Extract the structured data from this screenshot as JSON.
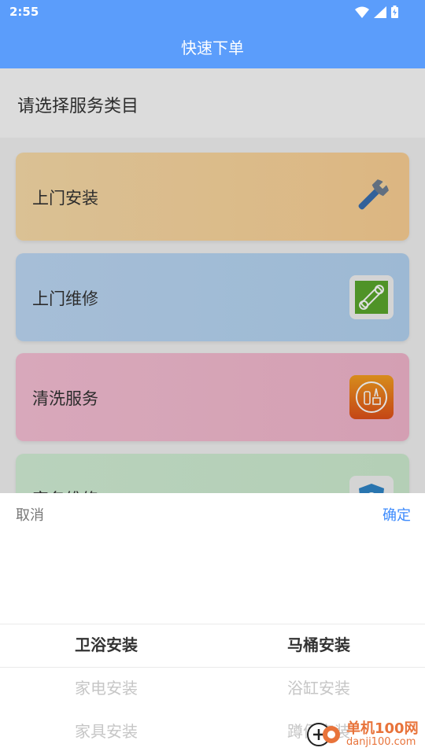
{
  "status_bar": {
    "time": "2:55"
  },
  "app_bar": {
    "title": "快速下单"
  },
  "section": {
    "title": "请选择服务类目"
  },
  "services": [
    {
      "label": "上门安装",
      "icon": "wrench-icon"
    },
    {
      "label": "上门维修",
      "icon": "wrench-tile-icon"
    },
    {
      "label": "清洗服务",
      "icon": "cleaning-tools-icon"
    },
    {
      "label": "家务维修",
      "icon": "shield-icon"
    }
  ],
  "picker": {
    "cancel_label": "取消",
    "confirm_label": "确定",
    "left_column": [
      "卫浴安装",
      "家电安装",
      "家具安装"
    ],
    "right_column": [
      "马桶安装",
      "浴缸安装",
      "蹲便安装"
    ]
  },
  "watermark": {
    "text": "单机100网",
    "url": "danji100.com"
  },
  "colors": {
    "primary": "#5b9dfb",
    "confirm": "#3d8bfd"
  }
}
